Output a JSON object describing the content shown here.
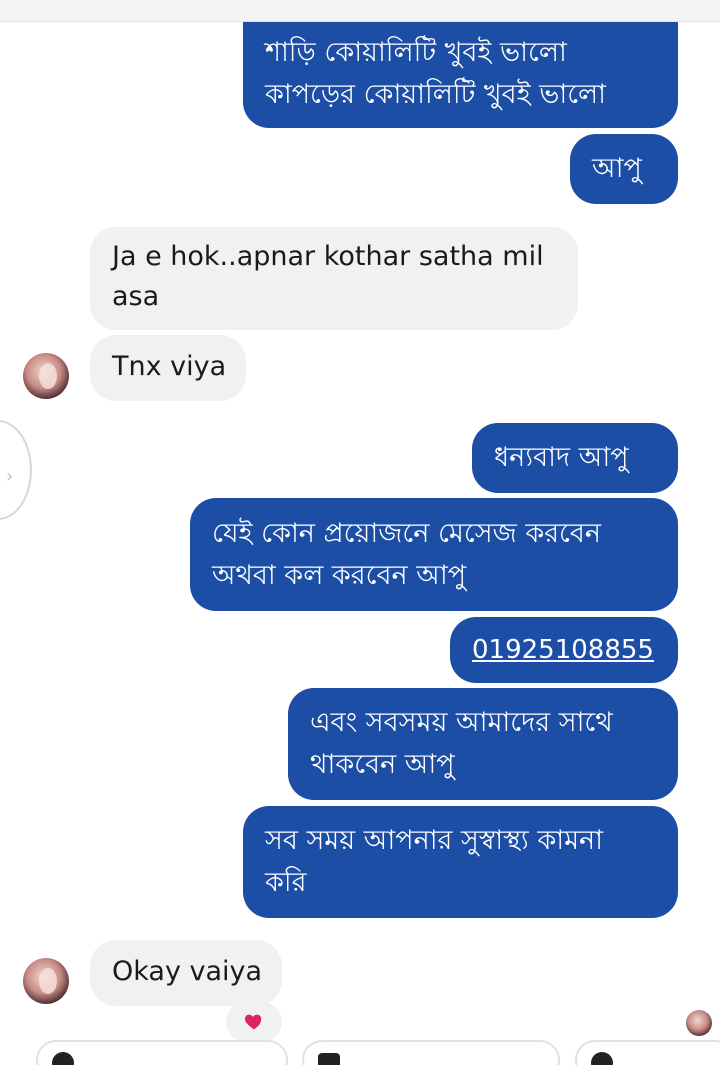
{
  "messages": {
    "m1": {
      "line1": "শাড়ি কোয়ালিটি খুবই ভালো",
      "line2": "কাপড়ের কোয়ালিটি খুবই ভালো"
    },
    "m2": {
      "text": "আপু"
    },
    "m3": {
      "line1": "Ja e hok..apnar kothar satha mil",
      "line2": "asa"
    },
    "m4": {
      "text": "Tnx viya"
    },
    "m5": {
      "text": "ধন্যবাদ আপু"
    },
    "m6": {
      "line1": "যেই কোন প্রয়োজনে মেসেজ করবেন",
      "line2": "অথবা কল করবেন আপু"
    },
    "m7": {
      "text": "01925108855"
    },
    "m8": {
      "line1": "এবং সবসময় আমাদের সাথে",
      "line2": "থাকবেন আপু"
    },
    "m9": {
      "line1": "সব সময় আপনার সুস্বাস্থ্য কামনা",
      "line2": "করি"
    },
    "m10": {
      "text": "Okay vaiya"
    }
  },
  "reaction": {
    "emoji": "heart",
    "color": "#e0245e"
  },
  "colors": {
    "sent_bubble": "#1c4ea6",
    "received_bubble": "#f0f1f3"
  },
  "icons": {
    "sender_avatar": "contact-avatar",
    "seen_avatar": "seen-avatar"
  }
}
